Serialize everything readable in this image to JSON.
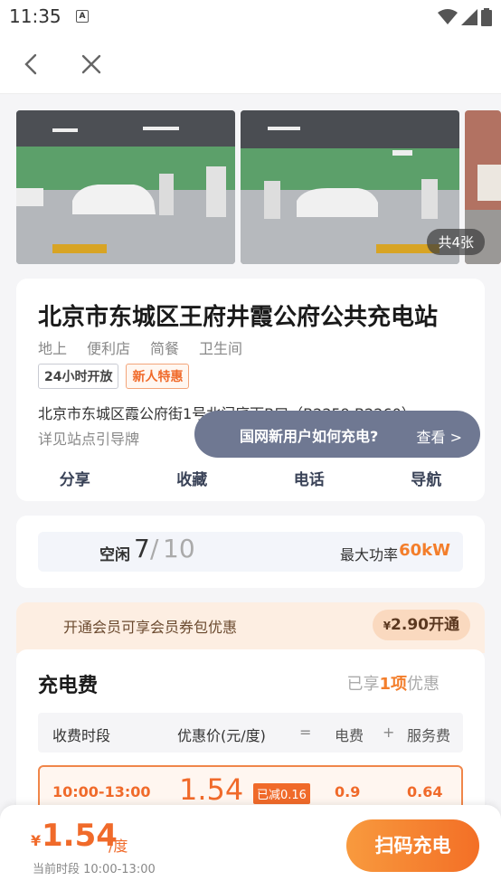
{
  "status_bar": {
    "time": "11:35",
    "notification_letter": "A"
  },
  "gallery": {
    "photo_count": "共4张"
  },
  "station": {
    "name": "北京市东城区王府井霞公府公共充电站",
    "tags": [
      "地上",
      "便利店",
      "简餐",
      "卫生间"
    ],
    "badges": {
      "open": "24小时开放",
      "new_user": "新人特惠"
    },
    "address": "北京市东城区霞公府街1号北门底下B口（B2259-B2260）",
    "address_note": "详见站点引导牌",
    "actions": {
      "share": "分享",
      "favorite": "收藏",
      "phone": "电话",
      "navigate": "导航"
    }
  },
  "help_pill": {
    "text": "国网新用户如何充电?",
    "link": "查看 >"
  },
  "availability": {
    "label": "空闲",
    "free": "7",
    "separator": "/",
    "total": "10",
    "power_label": "最大功率",
    "power_value": "60kW"
  },
  "member": {
    "text": "开通会员可享会员券包优惠",
    "currency": "¥",
    "price": "2.90",
    "action": "开通"
  },
  "fee": {
    "title": "充电费",
    "discount_prefix": "已享",
    "discount_count": "1项",
    "discount_suffix": "优惠",
    "header": {
      "period": "收费时段",
      "price": "优惠价(元/度)",
      "eq": "=",
      "electricity": "电费",
      "plus": "+",
      "service": "服务费"
    },
    "row": {
      "period": "10:00-13:00",
      "price": "1.54",
      "reduced": "已减0.16",
      "electricity": "0.9",
      "service": "0.64"
    }
  },
  "bottom": {
    "currency": "¥",
    "price": "1.54",
    "unit": "/度",
    "period": "当前时段 10:00-13:00",
    "scan_button": "扫码充电"
  },
  "colors": {
    "accent": "#f06a2a",
    "pill": "#6f7892",
    "member_bg": "#fdeee2"
  }
}
